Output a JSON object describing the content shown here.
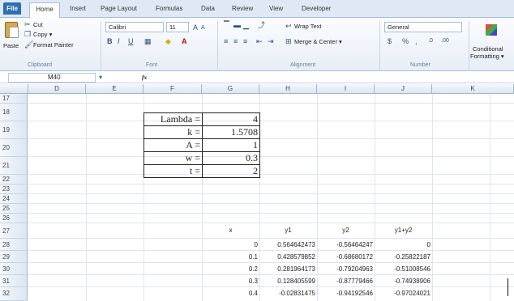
{
  "ribbon": {
    "tabs": [
      "File",
      "Home",
      "Insert",
      "Page Layout",
      "Formulas",
      "Data",
      "Review",
      "View",
      "Developer"
    ],
    "clipboard": {
      "cut": "Cut",
      "copy": "Copy ▾",
      "paste": "Paste",
      "format_painter": "Format Painter",
      "label": "Clipboard"
    },
    "font": {
      "name": "Calibri",
      "size": "11",
      "label": "Font"
    },
    "alignment": {
      "wrap": "Wrap Text",
      "merge": "Merge & Center ▾",
      "label": "Alignment"
    },
    "number": {
      "format": "General",
      "label": "Number"
    },
    "styles": {
      "conditional": "Conditional",
      "formatting": "Formatting ▾"
    }
  },
  "formula_bar": {
    "name_box": "M40",
    "fx": "fx"
  },
  "columns": [
    "D",
    "E",
    "F",
    "G",
    "H",
    "I",
    "J",
    "K"
  ],
  "rows": [
    "17",
    "18",
    "19",
    "20",
    "21",
    "22",
    "23",
    "24",
    "25",
    "26",
    "27",
    "28",
    "29",
    "30",
    "31",
    "32"
  ],
  "params": [
    {
      "label": "Lambda =",
      "value": "4"
    },
    {
      "label": "k =",
      "value": "1.5708"
    },
    {
      "label": "A =",
      "value": "1"
    },
    {
      "label": "w =",
      "value": "0.3"
    },
    {
      "label": "t =",
      "value": "2"
    }
  ],
  "table": {
    "headers": [
      "x",
      "y1",
      "y2",
      "y1+y2"
    ],
    "rows": [
      [
        "0",
        "0.564642473",
        "-0.56464247",
        "0"
      ],
      [
        "0.1",
        "0.428579852",
        "-0.68680172",
        "-0.25822187"
      ],
      [
        "0.2",
        "0.281964173",
        "-0.79204963",
        "-0.51008546"
      ],
      [
        "0.3",
        "0.128405599",
        "-0.87779466",
        "-0.74938906"
      ],
      [
        "0.4",
        "-0.02831475",
        "-0.94192546",
        "-0.97024021"
      ]
    ]
  }
}
